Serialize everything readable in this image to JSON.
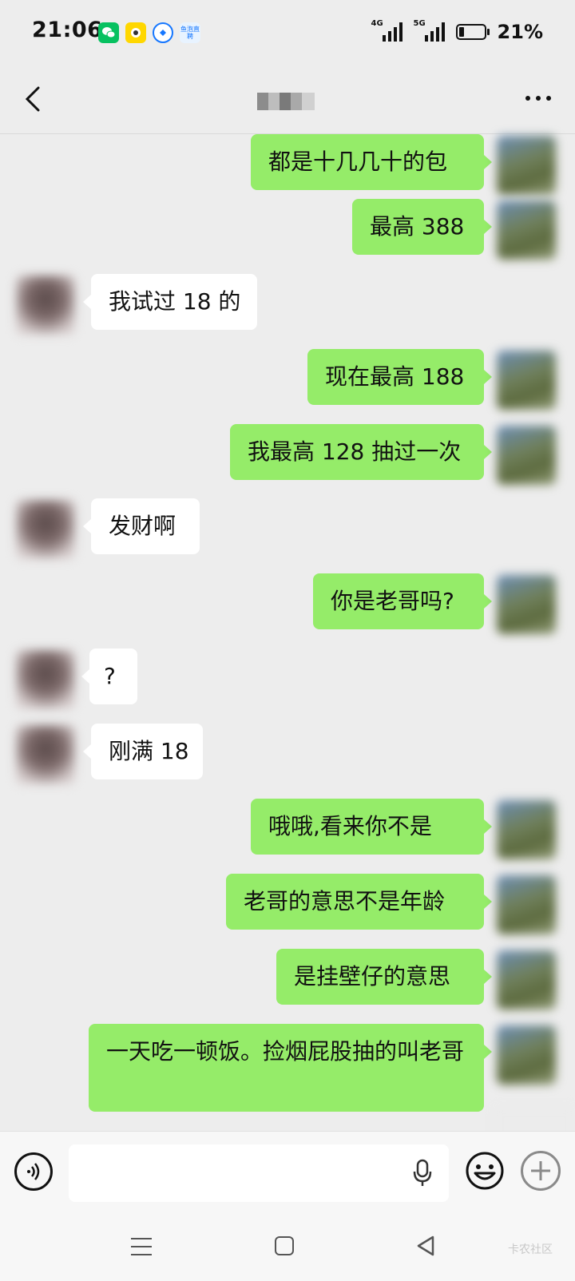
{
  "status_bar": {
    "time": "21:06",
    "battery_percent": "21%",
    "battery_level": 0.21,
    "network1": "4G",
    "network2": "5G",
    "app_icons": [
      "wechat-icon",
      "xianyu-icon",
      "app-icon-blue",
      "yupao-icon"
    ],
    "yupao_label": "鱼泡直聘"
  },
  "nav": {
    "back_icon": "chevron-left-icon",
    "more_icon": "more-horizontal-icon"
  },
  "messages": [
    {
      "side": "out",
      "text": "都是十几几十的包"
    },
    {
      "side": "out",
      "text": "最高 388"
    },
    {
      "side": "in",
      "text": "我试过 18 的"
    },
    {
      "side": "out",
      "text": "现在最高 188"
    },
    {
      "side": "out",
      "text": "我最高 128 抽过一次"
    },
    {
      "side": "in",
      "text": "发财啊"
    },
    {
      "side": "out",
      "text": "你是老哥吗?"
    },
    {
      "side": "in",
      "text": "?"
    },
    {
      "side": "in",
      "text": "刚满 18"
    },
    {
      "side": "out",
      "text": "哦哦,看来你不是"
    },
    {
      "side": "out",
      "text": "老哥的意思不是年龄"
    },
    {
      "side": "out",
      "text": "是挂壁仔的意思"
    },
    {
      "side": "out",
      "text": "一天吃一顿饭。捡烟屁股抽的叫老哥"
    }
  ],
  "input_bar": {
    "voice_icon": "voice-icon",
    "placeholder": "",
    "mic_icon": "microphone-icon",
    "emoji_icon": "emoji-icon",
    "plus_icon": "plus-icon"
  },
  "system_nav": {
    "menu_icon": "menu-icon",
    "home_icon": "home-icon",
    "back_icon": "back-triangle-icon",
    "watermark": "卡农社区"
  }
}
